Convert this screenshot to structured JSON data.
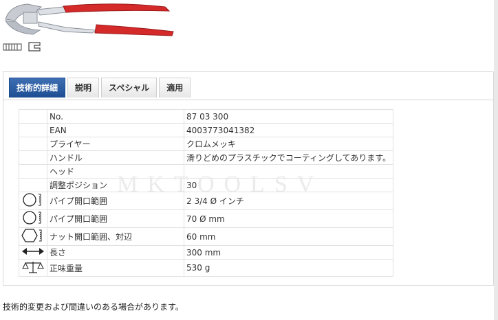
{
  "tabs": [
    {
      "label": "技術的詳細",
      "active": true
    },
    {
      "label": "説明",
      "active": false
    },
    {
      "label": "スペシャル",
      "active": false
    },
    {
      "label": "適用",
      "active": false
    }
  ],
  "specs": [
    {
      "icon": "",
      "label": "No.",
      "value": "87 03 300"
    },
    {
      "icon": "",
      "label": "EAN",
      "value": "4003773041382"
    },
    {
      "icon": "",
      "label": "プライヤー",
      "value": "クロムメッキ"
    },
    {
      "icon": "",
      "label": "ハンドル",
      "value": "滑りどめのプラスチックでコーティングしてあります。"
    },
    {
      "icon": "",
      "label": "ヘッド",
      "value": ""
    },
    {
      "icon": "",
      "label": "調整ポジション",
      "value": "30"
    },
    {
      "icon": "round-pipe-icon",
      "label": "パイプ開口範囲",
      "value": "2 3/4 Ø インチ"
    },
    {
      "icon": "round-pipe-icon",
      "label": "パイプ開口範囲",
      "value": "70 Ø mm"
    },
    {
      "icon": "hex-nut-icon",
      "label": "ナット開口範囲、対辺",
      "value": "60 mm"
    },
    {
      "icon": "length-arrow-icon",
      "label": "長さ",
      "value": "300 mm"
    },
    {
      "icon": "scale-icon",
      "label": "正味重量",
      "value": "530 g"
    }
  ],
  "watermark": "MKTOOLSV",
  "footnote": "技術的変更および間違いのある場合があります。",
  "colors": {
    "accent": "#1c4d93",
    "handle": "#d42a2a"
  }
}
